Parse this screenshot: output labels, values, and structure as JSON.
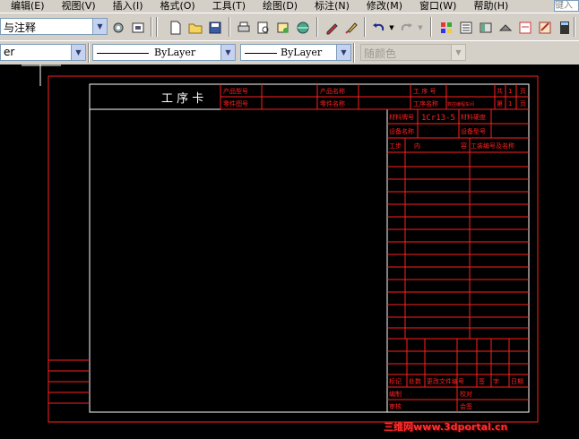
{
  "menubar": {
    "items": [
      "编辑(E)",
      "视图(V)",
      "插入(I)",
      "格式(O)",
      "工具(T)",
      "绘图(D)",
      "标注(N)",
      "修改(M)",
      "窗口(W)",
      "帮助(H)"
    ],
    "search_placeholder": "键入"
  },
  "toolbar1": {
    "style_combo_value": "与注释"
  },
  "toolbar2": {
    "layer_combo_value": "er",
    "color_combo_value": "ByLayer",
    "linetype_combo_value": "ByLayer",
    "plotstyle_combo_value": "随颜色"
  },
  "card": {
    "title": "工 序 卡",
    "product_model": "产品型号",
    "product_name": "产品名称",
    "process_no": "工 序 号",
    "part_drawing_no": "零件图号",
    "part_name": "零件名称",
    "process_name": "工序名称",
    "process_name_extra": "数控编程车间",
    "total_label": "共",
    "total_value": "1",
    "page_label": "页",
    "sheet_label": "第",
    "sheet_value": "1",
    "sheet_page_label": "页",
    "material_grade": "材料牌号",
    "material_value": "1Cr13-5",
    "material_hardness": "材料硬度",
    "equipment_name": "设备名称",
    "equipment_model": "设备型号",
    "step_label": "工步",
    "content_label": "内",
    "content_label2": "容",
    "tool_label": "工装编号及名称",
    "mark_label": "标记",
    "count_label": "处数",
    "change_doc_label": "更改文件编号",
    "sign_label": "签",
    "date_short_label": "字",
    "date_label": "日期",
    "prepared_label": "编制",
    "checked_label": "校对",
    "review_label": "审核",
    "approve_label": "会签"
  },
  "watermark": "三维网www.3dportal.cn",
  "colors": {
    "frame": "#ff2020",
    "inner": "#ffffff",
    "chrome": "#d4d0c8"
  }
}
